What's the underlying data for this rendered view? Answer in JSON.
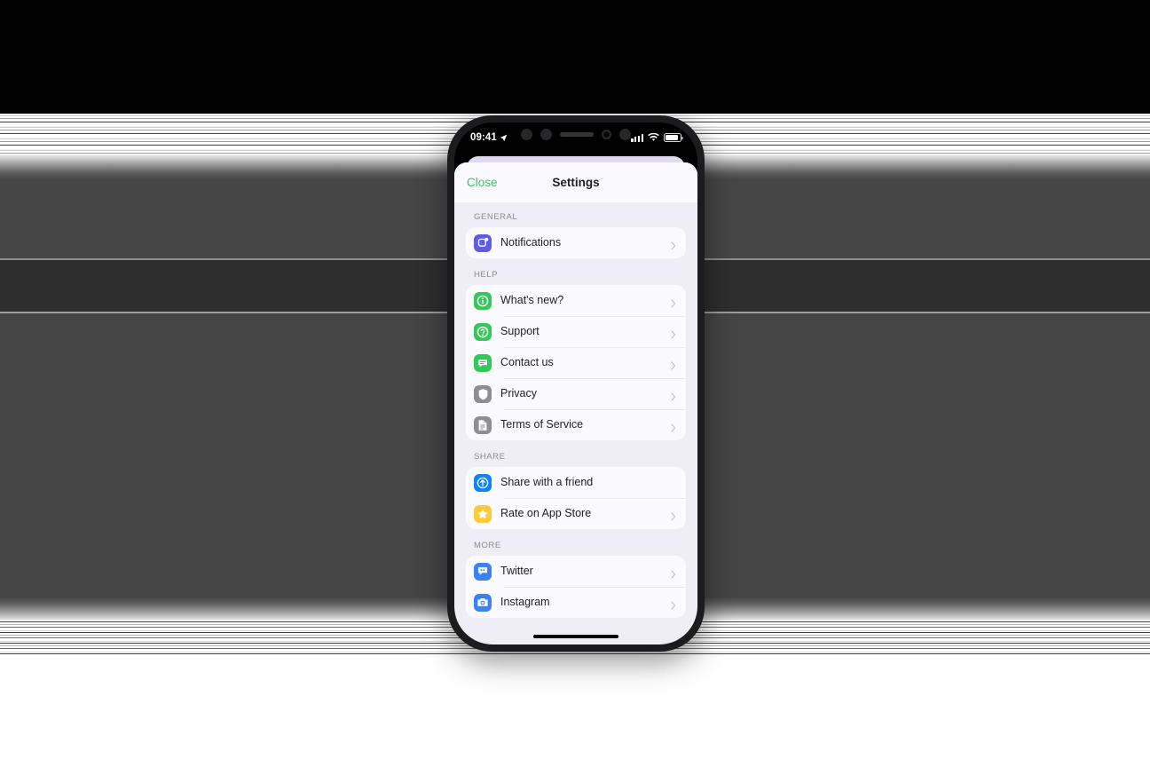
{
  "status_bar": {
    "time": "09:41",
    "location_icon": "location-arrow-icon",
    "signal_icon": "cellular-signal-icon",
    "wifi_icon": "wifi-icon",
    "battery_icon": "battery-icon"
  },
  "sheet": {
    "close_label": "Close",
    "title": "Settings"
  },
  "colors": {
    "accent_green": "#34c759",
    "icon_purple": "#5e5ce6",
    "icon_green": "#34c759",
    "icon_gray": "#8e8e93",
    "icon_blue": "#0a84ff",
    "icon_yellow": "#ffc93c",
    "sheet_background": "#efedf6",
    "card_background": "#fbfaff"
  },
  "sections": [
    {
      "title": "GENERAL",
      "rows": [
        {
          "label": "Notifications",
          "icon": "notification-square-icon",
          "icon_color": "#5e5ce6",
          "chevron": true
        }
      ]
    },
    {
      "title": "HELP",
      "rows": [
        {
          "label": "What's new?",
          "icon": "info-circle-icon",
          "icon_color": "#34c759",
          "chevron": true
        },
        {
          "label": "Support",
          "icon": "question-circle-icon",
          "icon_color": "#34c759",
          "chevron": true
        },
        {
          "label": "Contact us",
          "icon": "chat-bubble-icon",
          "icon_color": "#34c759",
          "chevron": true
        },
        {
          "label": "Privacy",
          "icon": "shield-icon",
          "icon_color": "#8e8e93",
          "chevron": true
        },
        {
          "label": "Terms of Service",
          "icon": "document-icon",
          "icon_color": "#8e8e93",
          "chevron": true
        }
      ]
    },
    {
      "title": "SHARE",
      "rows": [
        {
          "label": "Share with a friend",
          "icon": "share-arrow-icon",
          "icon_color": "#0a84ff",
          "chevron": false
        },
        {
          "label": "Rate on App Store",
          "icon": "star-icon",
          "icon_color": "#ffc93c",
          "chevron": true
        }
      ]
    },
    {
      "title": "MORE",
      "rows": [
        {
          "label": "Twitter",
          "icon": "twitter-bubble-icon",
          "icon_color": "#3b82f6",
          "chevron": true
        },
        {
          "label": "Instagram",
          "icon": "camera-icon",
          "icon_color": "#3b82f6",
          "chevron": true
        }
      ]
    }
  ]
}
